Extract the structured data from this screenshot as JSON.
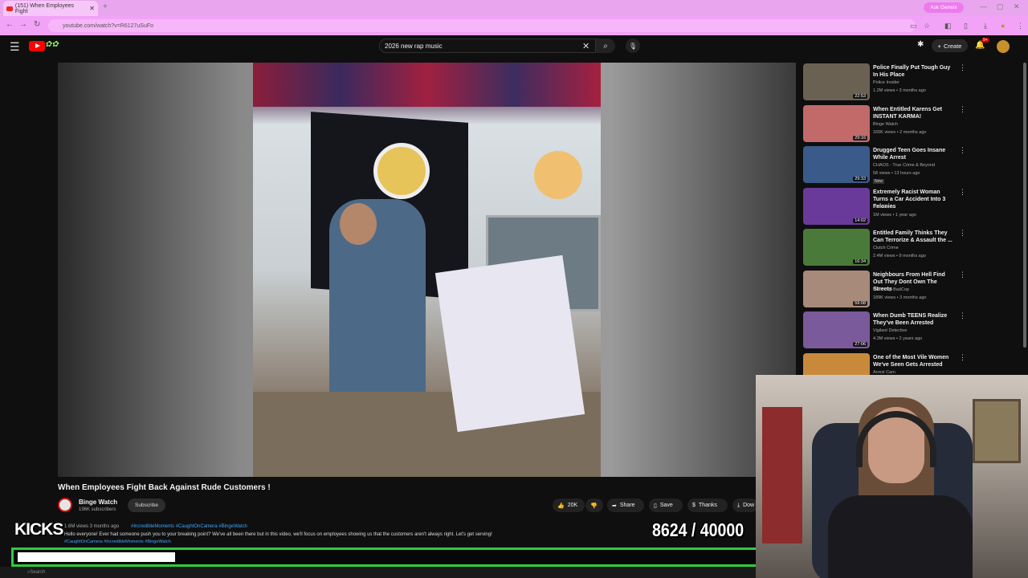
{
  "browser": {
    "tab_title": "(151) When Employees Fight",
    "url": "youtube.com/watch?v=R6127uSuFo",
    "gemini_label": "Ask Gemini"
  },
  "header": {
    "search_value": "2026 new rap music",
    "create_label": "Create",
    "notif_count": "9+"
  },
  "video": {
    "title": "When Employees Fight Back Against Rude Customers !",
    "channel": "Binge Watch",
    "subscribers": "196K subscribers",
    "subscribe_label": "Subscribe",
    "likes": "20K",
    "share_label": "Share",
    "save_label": "Save",
    "thanks_label": "Thanks",
    "download_label": "Dow",
    "meta": "1.6M views  3 months ago",
    "tags": "#IncredibleMoments #CaughtOnCamera #BingeWatch",
    "description": "Hello everyone! Ever had someone push you to your breaking point? We've all been there but in this video, we'll focus on employees showing us that the customers aren't always right. Let's get serving!",
    "tags2": "#CaughtOnCamera #IncredibleMoments #BingeWatch"
  },
  "overlay": {
    "kicks_label": "KICKS",
    "goal_text": "8624  /  40000",
    "progress": 0.2156
  },
  "taskbar": {
    "search": "Search"
  },
  "recommendations": [
    {
      "title": "Police Finally Put Tough Guy In His Place",
      "channel": "Police Insider",
      "views": "1.2M views • 3 months ago",
      "duration": "22:53",
      "color": "#6b6152",
      "new": ""
    },
    {
      "title": "When Entitled Karens Get INSTANT KARMA!",
      "channel": "Binge Watch",
      "views": "165K views • 2 months ago",
      "duration": "29:16",
      "color": "#c26a6a",
      "new": ""
    },
    {
      "title": "Drugged Teen Goes Insane While Arrest",
      "channel": "CHAOS - True Crime & Beyond",
      "views": "58 views • 13 hours ago",
      "duration": "29:33",
      "color": "#3a5a8a",
      "new": "New"
    },
    {
      "title": "Extremely Racist Woman Turns a Car Accident Into 3 Felonies",
      "channel": "Uncovered",
      "views": "1M views • 1 year ago",
      "duration": "14:02",
      "color": "#6a3a9a",
      "new": ""
    },
    {
      "title": "Entitled Family Thinks They Can Terrorize & Assault the ...",
      "channel": "Clutch Crime",
      "views": "2.4M views • 9 months ago",
      "duration": "16:34",
      "color": "#4a7a3a",
      "new": ""
    },
    {
      "title": "Neighbours From Hell Find Out They Dont Own The Streets",
      "channel": "GoodCop BadCop",
      "views": "189K views • 3 months ago",
      "duration": "59:08",
      "color": "#a88a7a",
      "new": ""
    },
    {
      "title": "When Dumb TEENS Realize They've Been Arrested",
      "channel": "Vigilant Detective",
      "views": "4.3M views • 2 years ago",
      "duration": "27:06",
      "color": "#7a5a9a",
      "new": ""
    },
    {
      "title": "One of the Most Vile Women We've Seen Gets Arrested",
      "channel": "Arrest Cam",
      "views": "",
      "duration": "",
      "color": "#c88a3a",
      "new": ""
    }
  ]
}
